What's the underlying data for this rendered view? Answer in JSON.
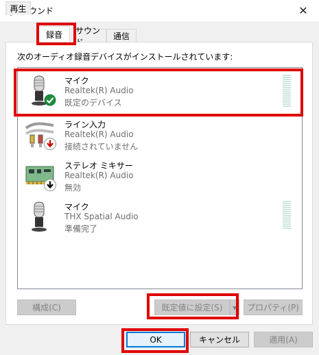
{
  "window": {
    "title": "サウンド",
    "close_glyph": "✕"
  },
  "tabs": [
    {
      "label": "再生"
    },
    {
      "label": "録音"
    },
    {
      "label": "サウンド"
    },
    {
      "label": "通信"
    }
  ],
  "panel": {
    "instruction": "次のオーディオ録音デバイスがインストールされています:",
    "devices": [
      {
        "name": "マイク",
        "driver": "Realtek(R) Audio",
        "status": "既定のデバイス",
        "icon": "microphone-icon",
        "badge": "green-check-badge",
        "meter": true
      },
      {
        "name": "ライン入力",
        "driver": "Realtek(R) Audio",
        "status": "接続されていません",
        "icon": "line-in-cable-icon",
        "badge": "red-down-arrow-badge",
        "meter": false
      },
      {
        "name": "ステレオ ミキサー",
        "driver": "Realtek(R) Audio",
        "status": "無効",
        "icon": "sound-card-icon",
        "badge": "black-down-arrow-badge",
        "meter": false
      },
      {
        "name": "マイク",
        "driver": "THX Spatial Audio",
        "status": "準備完了",
        "icon": "microphone-icon",
        "badge": "",
        "meter": true
      }
    ],
    "buttons": {
      "configure": "構成(C)",
      "set_default": "既定値に設定(S)",
      "dropdown_glyph": "▾",
      "properties": "プロパティ(P)"
    }
  },
  "footer": {
    "ok": "OK",
    "cancel": "キャンセル",
    "apply": "適用(A)"
  },
  "colors": {
    "highlight": "#e00000",
    "focus": "#0078d7",
    "check": "#1d8a3a",
    "red_badge": "#d00000"
  }
}
